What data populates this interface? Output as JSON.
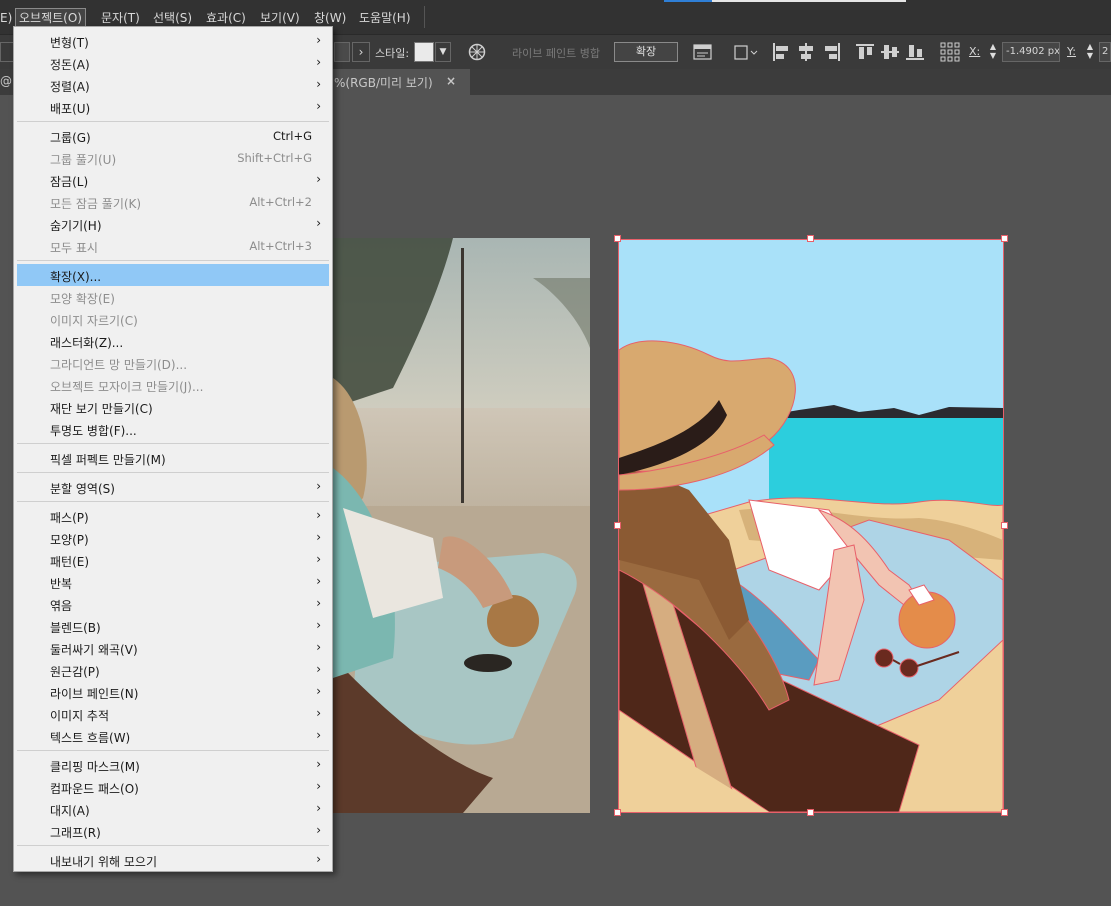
{
  "menubar": {
    "items": [
      {
        "label": "E)"
      },
      {
        "label": "오브젝트(O)"
      },
      {
        "label": "문자(T)"
      },
      {
        "label": "선택(S)"
      },
      {
        "label": "효과(C)"
      },
      {
        "label": "보기(V)"
      },
      {
        "label": "창(W)"
      },
      {
        "label": "도움말(H)"
      }
    ]
  },
  "control_bar": {
    "style_label": "스타일:",
    "live_paint_label": "라이브 페인트 병합",
    "expand_button": "확장",
    "x_label": "X:",
    "x_value": "-1.4902 px",
    "y_label": "Y:",
    "y_value": "2"
  },
  "tab": {
    "left_edge": "@",
    "title": "%(RGB/미리 보기)",
    "close": "×"
  },
  "object_menu": {
    "items": [
      {
        "label": "변형(T)",
        "shortcut": "",
        "submenu": true,
        "disabled": false,
        "highlighted": false
      },
      {
        "label": "정돈(A)",
        "shortcut": "",
        "submenu": true,
        "disabled": false,
        "highlighted": false
      },
      {
        "label": "정렬(A)",
        "shortcut": "",
        "submenu": true,
        "disabled": false,
        "highlighted": false
      },
      {
        "label": "배포(U)",
        "shortcut": "",
        "submenu": true,
        "disabled": false,
        "highlighted": false
      },
      {
        "label": "그룹(G)",
        "shortcut": "Ctrl+G",
        "submenu": false,
        "disabled": false,
        "highlighted": false
      },
      {
        "label": "그룹 풀기(U)",
        "shortcut": "Shift+Ctrl+G",
        "submenu": false,
        "disabled": true,
        "highlighted": false
      },
      {
        "label": "잠금(L)",
        "shortcut": "",
        "submenu": true,
        "disabled": false,
        "highlighted": false
      },
      {
        "label": "모든 잠금 풀기(K)",
        "shortcut": "Alt+Ctrl+2",
        "submenu": false,
        "disabled": true,
        "highlighted": false
      },
      {
        "label": "숨기기(H)",
        "shortcut": "",
        "submenu": true,
        "disabled": false,
        "highlighted": false
      },
      {
        "label": "모두 표시",
        "shortcut": "Alt+Ctrl+3",
        "submenu": false,
        "disabled": true,
        "highlighted": false
      },
      {
        "label": "확장(X)...",
        "shortcut": "",
        "submenu": false,
        "disabled": false,
        "highlighted": true
      },
      {
        "label": "모양 확장(E)",
        "shortcut": "",
        "submenu": false,
        "disabled": true,
        "highlighted": false
      },
      {
        "label": "이미지 자르기(C)",
        "shortcut": "",
        "submenu": false,
        "disabled": true,
        "highlighted": false
      },
      {
        "label": "래스터화(Z)...",
        "shortcut": "",
        "submenu": false,
        "disabled": false,
        "highlighted": false
      },
      {
        "label": "그라디언트 망 만들기(D)...",
        "shortcut": "",
        "submenu": false,
        "disabled": true,
        "highlighted": false
      },
      {
        "label": "오브젝트 모자이크 만들기(J)...",
        "shortcut": "",
        "submenu": false,
        "disabled": true,
        "highlighted": false
      },
      {
        "label": "재단 보기 만들기(C)",
        "shortcut": "",
        "submenu": false,
        "disabled": false,
        "highlighted": false
      },
      {
        "label": "투명도 병합(F)...",
        "shortcut": "",
        "submenu": false,
        "disabled": false,
        "highlighted": false
      },
      {
        "label": "픽셀 퍼펙트 만들기(M)",
        "shortcut": "",
        "submenu": false,
        "disabled": false,
        "highlighted": false
      },
      {
        "label": "분할 영역(S)",
        "shortcut": "",
        "submenu": true,
        "disabled": false,
        "highlighted": false
      },
      {
        "label": "패스(P)",
        "shortcut": "",
        "submenu": true,
        "disabled": false,
        "highlighted": false
      },
      {
        "label": "모양(P)",
        "shortcut": "",
        "submenu": true,
        "disabled": false,
        "highlighted": false
      },
      {
        "label": "패턴(E)",
        "shortcut": "",
        "submenu": true,
        "disabled": false,
        "highlighted": false
      },
      {
        "label": "반복",
        "shortcut": "",
        "submenu": true,
        "disabled": false,
        "highlighted": false
      },
      {
        "label": "엮음",
        "shortcut": "",
        "submenu": true,
        "disabled": false,
        "highlighted": false
      },
      {
        "label": "블렌드(B)",
        "shortcut": "",
        "submenu": true,
        "disabled": false,
        "highlighted": false
      },
      {
        "label": "둘러싸기 왜곡(V)",
        "shortcut": "",
        "submenu": true,
        "disabled": false,
        "highlighted": false
      },
      {
        "label": "원근감(P)",
        "shortcut": "",
        "submenu": true,
        "disabled": false,
        "highlighted": false
      },
      {
        "label": "라이브 페인트(N)",
        "shortcut": "",
        "submenu": true,
        "disabled": false,
        "highlighted": false
      },
      {
        "label": "이미지 추적",
        "shortcut": "",
        "submenu": true,
        "disabled": false,
        "highlighted": false
      },
      {
        "label": "텍스트 흐름(W)",
        "shortcut": "",
        "submenu": true,
        "disabled": false,
        "highlighted": false
      },
      {
        "label": "클리핑 마스크(M)",
        "shortcut": "",
        "submenu": true,
        "disabled": false,
        "highlighted": false
      },
      {
        "label": "컴파운드 패스(O)",
        "shortcut": "",
        "submenu": true,
        "disabled": false,
        "highlighted": false
      },
      {
        "label": "대지(A)",
        "shortcut": "",
        "submenu": true,
        "disabled": false,
        "highlighted": false
      },
      {
        "label": "그래프(R)",
        "shortcut": "",
        "submenu": true,
        "disabled": false,
        "highlighted": false
      },
      {
        "label": "내보내기 위해 모으기",
        "shortcut": "",
        "submenu": true,
        "disabled": false,
        "highlighted": false
      }
    ],
    "arrow_glyph": "›"
  },
  "colors": {
    "highlight": "#90c8f6",
    "selection": "#e8606a",
    "sky": "#a9e1f9",
    "sea": "#2ccedd",
    "sand": "#efd09a",
    "hat": "#d8a96f",
    "hair": "#9a6a3f"
  }
}
